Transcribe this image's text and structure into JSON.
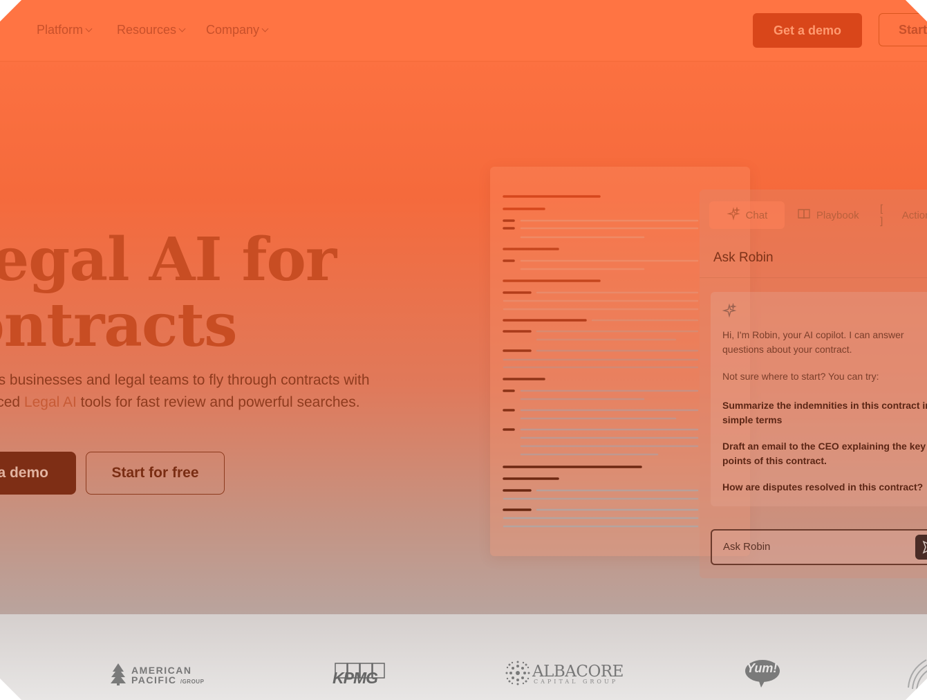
{
  "nav": {
    "items": [
      {
        "label": "Platform"
      },
      {
        "label": "Resources"
      },
      {
        "label": "Company"
      }
    ],
    "demo_label": "Get a demo",
    "start_label": "Start for free"
  },
  "hero": {
    "title_line1": "Legal AI for",
    "title_line2": "contracts",
    "subtitle_pre": "Robin AI empowers businesses and legal teams to fly through contracts with advanced ",
    "subtitle_highlight": "Legal AI",
    "subtitle_post": " tools for fast review and powerful searches.",
    "demo_label": "Get a demo",
    "free_label": "Start for free"
  },
  "chat": {
    "tabs": [
      {
        "label": "Chat",
        "icon": "sparkle-icon"
      },
      {
        "label": "Playbook",
        "icon": "book-icon"
      },
      {
        "label": "Actions",
        "icon": "brackets-icon"
      }
    ],
    "title": "Ask Robin",
    "intro": "Hi, I'm Robin, your AI copilot. I can answer questions about your contract.",
    "prompt": "Not sure where to start? You can try:",
    "suggestions": [
      "Summarize the indemnities in this contract in simple terms",
      "Draft an email to the CEO explaining the key points of this contract.",
      "How are disputes resolved in this contract?"
    ],
    "input_placeholder": "Ask Robin"
  },
  "logos": {
    "american_pacific_line1": "AMERICAN",
    "american_pacific_line2": "PACIFIC",
    "american_pacific_suffix": "/GROUP",
    "kpmg": "KPMG",
    "albacore": "ALBACORE",
    "albacore_sub": "CAPITAL GROUP",
    "yum": "Yum!"
  },
  "colors": {
    "brand_orange": "#ff7443",
    "button_dark": "#d9461a",
    "headline": "#c84d23"
  }
}
